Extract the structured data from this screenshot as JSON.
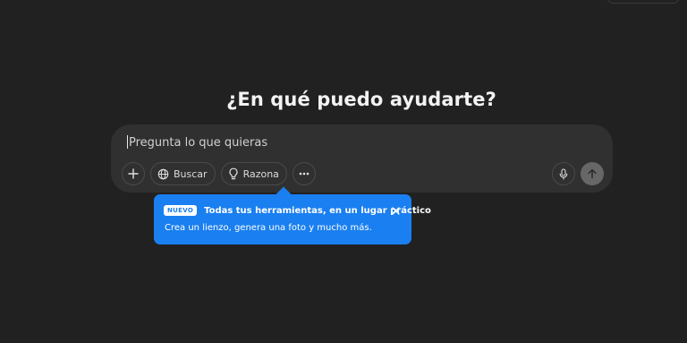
{
  "header": {
    "headline": "¿En qué puedo ayudarte?"
  },
  "composer": {
    "placeholder": "Pregunta lo que quieras",
    "tools": {
      "add_icon": "plus-icon",
      "search_label": "Buscar",
      "search_icon": "globe-icon",
      "reason_label": "Razona",
      "reason_icon": "lightbulb-icon",
      "more_icon": "ellipsis-icon"
    },
    "mic_icon": "microphone-icon",
    "send_icon": "arrow-up-icon"
  },
  "tooltip": {
    "badge": "NUEVO",
    "title": "Todas tus herramientas, en un lugar práctico",
    "description": "Crea un lienzo, genera una foto y mucho más.",
    "close_icon": "close-icon",
    "color": "#1a7ff0"
  },
  "theme": {
    "background": "#212121",
    "composer_bg": "#303030"
  }
}
